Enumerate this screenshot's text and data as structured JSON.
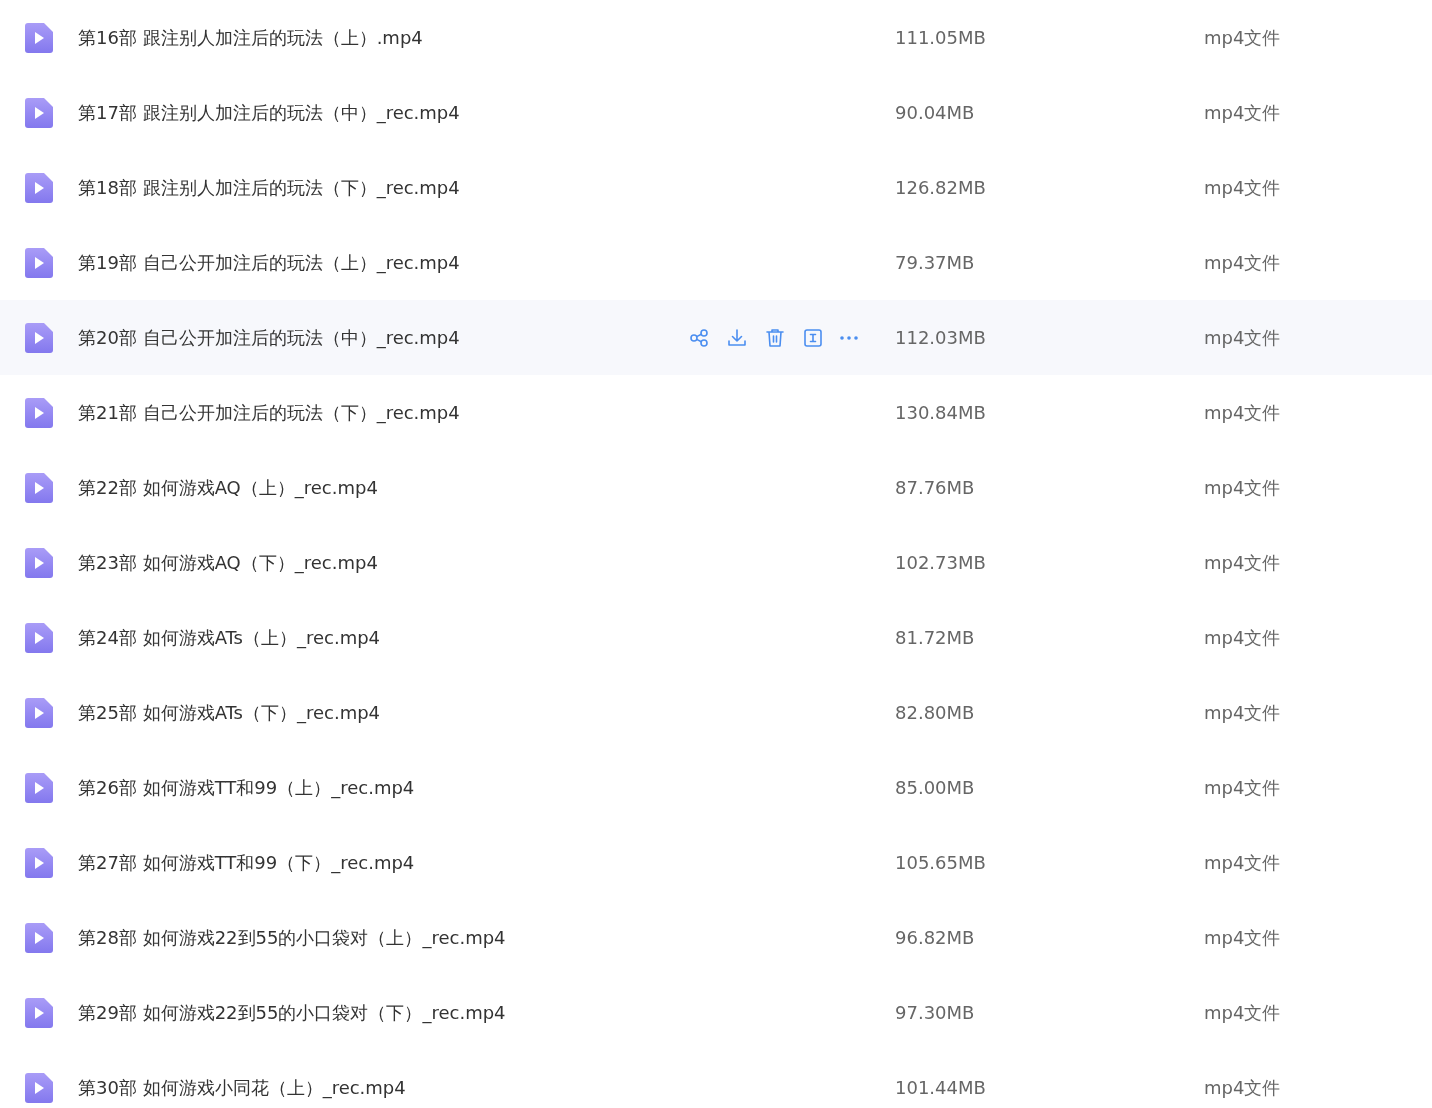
{
  "files": [
    {
      "name": "第16部 跟注别人加注后的玩法（上）.mp4",
      "size": "111.05MB",
      "type": "mp4文件",
      "hovered": false
    },
    {
      "name": "第17部 跟注别人加注后的玩法（中）_rec.mp4",
      "size": "90.04MB",
      "type": "mp4文件",
      "hovered": false
    },
    {
      "name": "第18部 跟注别人加注后的玩法（下）_rec.mp4",
      "size": "126.82MB",
      "type": "mp4文件",
      "hovered": false
    },
    {
      "name": "第19部 自己公开加注后的玩法（上）_rec.mp4",
      "size": "79.37MB",
      "type": "mp4文件",
      "hovered": false
    },
    {
      "name": "第20部 自己公开加注后的玩法（中）_rec.mp4",
      "size": "112.03MB",
      "type": "mp4文件",
      "hovered": true
    },
    {
      "name": "第21部 自己公开加注后的玩法（下）_rec.mp4",
      "size": "130.84MB",
      "type": "mp4文件",
      "hovered": false
    },
    {
      "name": "第22部 如何游戏AQ（上）_rec.mp4",
      "size": "87.76MB",
      "type": "mp4文件",
      "hovered": false
    },
    {
      "name": "第23部 如何游戏AQ（下）_rec.mp4",
      "size": "102.73MB",
      "type": "mp4文件",
      "hovered": false
    },
    {
      "name": "第24部 如何游戏ATs（上）_rec.mp4",
      "size": "81.72MB",
      "type": "mp4文件",
      "hovered": false
    },
    {
      "name": "第25部 如何游戏ATs（下）_rec.mp4",
      "size": "82.80MB",
      "type": "mp4文件",
      "hovered": false
    },
    {
      "name": "第26部 如何游戏TT和99（上）_rec.mp4",
      "size": "85.00MB",
      "type": "mp4文件",
      "hovered": false
    },
    {
      "name": "第27部 如何游戏TT和99（下）_rec.mp4",
      "size": "105.65MB",
      "type": "mp4文件",
      "hovered": false
    },
    {
      "name": "第28部 如何游戏22到55的小口袋对（上）_rec.mp4",
      "size": "96.82MB",
      "type": "mp4文件",
      "hovered": false
    },
    {
      "name": "第29部 如何游戏22到55的小口袋对（下）_rec.mp4",
      "size": "97.30MB",
      "type": "mp4文件",
      "hovered": false
    },
    {
      "name": "第30部 如何游戏小同花（上）_rec.mp4",
      "size": "101.44MB",
      "type": "mp4文件",
      "hovered": false
    }
  ]
}
